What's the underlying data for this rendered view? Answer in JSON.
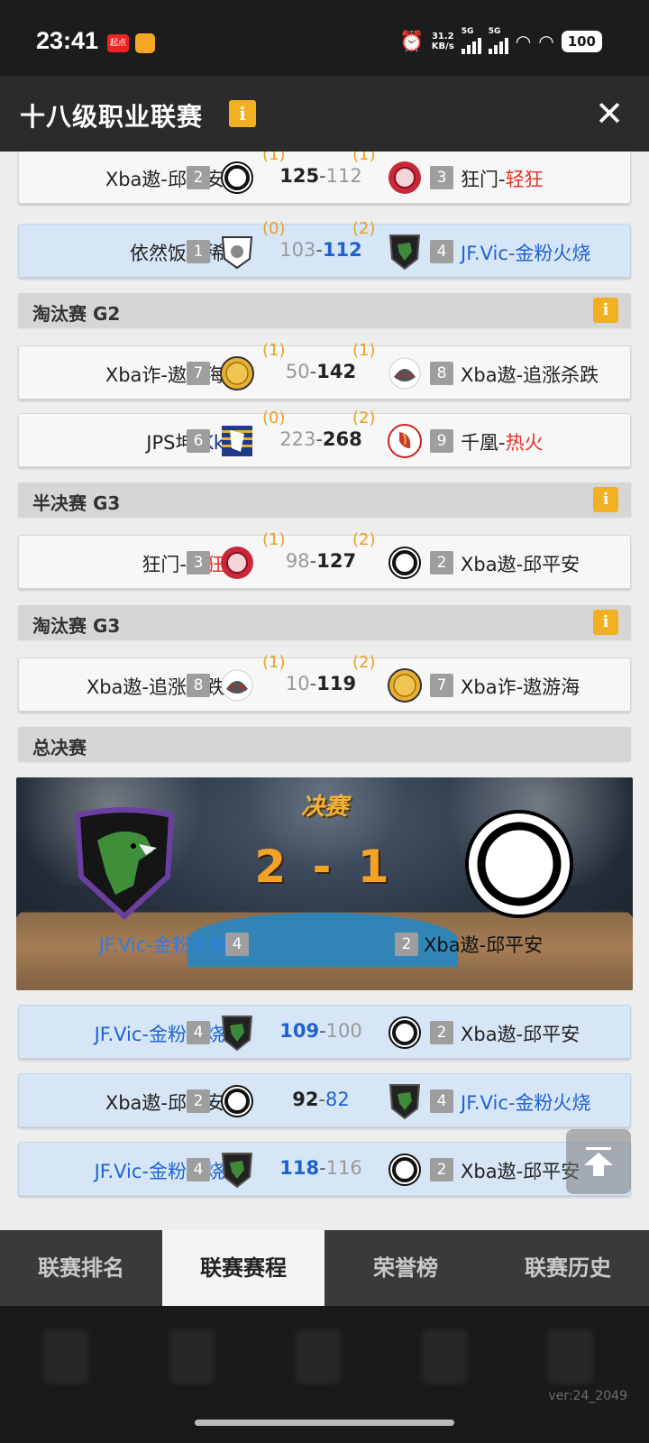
{
  "status_bar": {
    "time": "23:41",
    "badge": "起点",
    "speed_value": "31.2",
    "speed_unit": "KB/s",
    "signal1": "5G",
    "signal2": "5G",
    "battery": "100"
  },
  "header": {
    "title": "十八级职业联赛",
    "info": "i",
    "close": "✕"
  },
  "matches": [
    {
      "home": "Xba遨-邱平安",
      "home_rank": "2",
      "home_wins": "(1)",
      "home_score": "125",
      "away_score": "112",
      "away_wins": "(1)",
      "away_rank": "3",
      "away_prefix": "狂门-",
      "away_suffix": "轻狂"
    },
    {
      "home": "依然饭特稀",
      "home_rank": "1",
      "home_wins": "(0)",
      "home_score": "103",
      "away_score": "112",
      "away_wins": "(2)",
      "away_rank": "4",
      "away": "JF.Vic-金粉火烧"
    },
    {
      "home": "Xba诈-遨游海",
      "home_rank": "7",
      "home_wins": "(1)",
      "home_score": "50",
      "away_score": "142",
      "away_wins": "(1)",
      "away_rank": "8",
      "away": "Xba遨-追涨杀跌"
    },
    {
      "home_prefix": "JPS坤-",
      "home_suffix": "Kk",
      "home_rank": "6",
      "home_wins": "(0)",
      "home_score": "223",
      "away_score": "268",
      "away_wins": "(2)",
      "away_rank": "9",
      "away_prefix": "千凰-",
      "away_suffix": "热火"
    },
    {
      "home_prefix": "狂门-",
      "home_suffix": "轻狂",
      "home_rank": "3",
      "home_wins": "(1)",
      "home_score": "98",
      "away_score": "127",
      "away_wins": "(2)",
      "away_rank": "2",
      "away": "Xba遨-邱平安"
    },
    {
      "home": "Xba遨-追涨杀跌",
      "home_rank": "8",
      "home_wins": "(1)",
      "home_score": "10",
      "away_score": "119",
      "away_wins": "(2)",
      "away_rank": "7",
      "away": "Xba诈-遨游海"
    },
    {
      "home": "JF.Vic-金粉火烧",
      "home_rank": "4",
      "home_score": "109",
      "away_score": "100",
      "away_rank": "2",
      "away": "Xba遨-邱平安"
    },
    {
      "home": "Xba遨-邱平安",
      "home_rank": "2",
      "home_score": "92",
      "away_score": "82",
      "away_rank": "4",
      "away": "JF.Vic-金粉火烧"
    },
    {
      "home": "JF.Vic-金粉火烧",
      "home_rank": "4",
      "home_score": "118",
      "away_score": "116",
      "away_rank": "2",
      "away": "Xba遨-邱平安"
    }
  ],
  "sections": {
    "elim_g2": "淘汰赛 G2",
    "semi_g3": "半决赛 G3",
    "elim_g3": "淘汰赛 G3",
    "finals": "总决赛",
    "info": "i"
  },
  "final": {
    "title": "决赛",
    "score": "2 - 1",
    "left_team": "JF.Vic-金粉火烧",
    "left_rank": "4",
    "right_team": "Xba遨-邱平安",
    "right_rank": "2"
  },
  "score_dash": "-",
  "tabs": [
    "联赛排名",
    "联赛赛程",
    "荣誉榜",
    "联赛历史"
  ],
  "active_tab": "联赛赛程",
  "version": "ver:24_2049",
  "colors": {
    "header_bg": "#2b2b2b",
    "accent_gold": "#f0b021",
    "win_blue": "#1e62d0",
    "red_name": "#e4342a",
    "highlight_row": "#d7e6f6"
  }
}
